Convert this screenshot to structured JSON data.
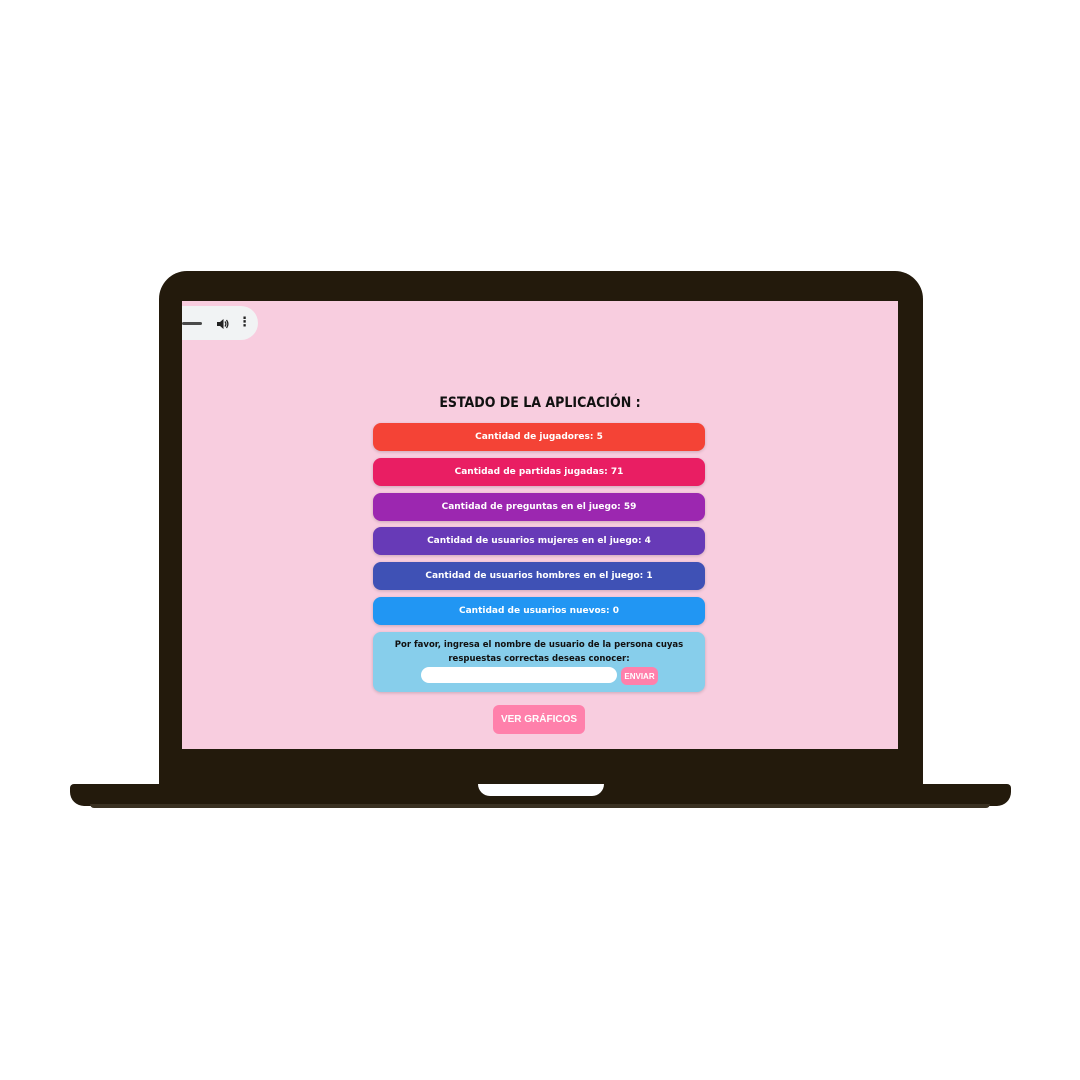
{
  "app": {
    "title": "ESTADO DE LA APLICACIÓN :",
    "stats": [
      {
        "label": "Cantidad de jugadores: 5",
        "color": "#f44336"
      },
      {
        "label": "Cantidad de partidas jugadas: 71",
        "color": "#e91e63"
      },
      {
        "label": "Cantidad de preguntas en el juego: 59",
        "color": "#9c27b0"
      },
      {
        "label": "Cantidad de usuarios mujeres en el juego: 4",
        "color": "#673ab7"
      },
      {
        "label": "Cantidad de usuarios hombres en el juego: 1",
        "color": "#3f51b5"
      },
      {
        "label": "Cantidad de usuarios nuevos: 0",
        "color": "#2196f3"
      }
    ],
    "query": {
      "prompt": "Por favor, ingresa el nombre de usuario de la persona cuyas respuestas correctas deseas conocer:",
      "input_value": "",
      "send_label": "ENVIAR"
    },
    "charts_label": "VER GRÁFICOS"
  },
  "media_controls": {
    "icons": [
      "volume-icon",
      "more-vert-icon"
    ]
  },
  "colors": {
    "screen_bg": "#f8cddf",
    "accent_pink": "#ff80ab",
    "query_bg": "#87ceeb",
    "laptop_body": "#231a0c"
  }
}
